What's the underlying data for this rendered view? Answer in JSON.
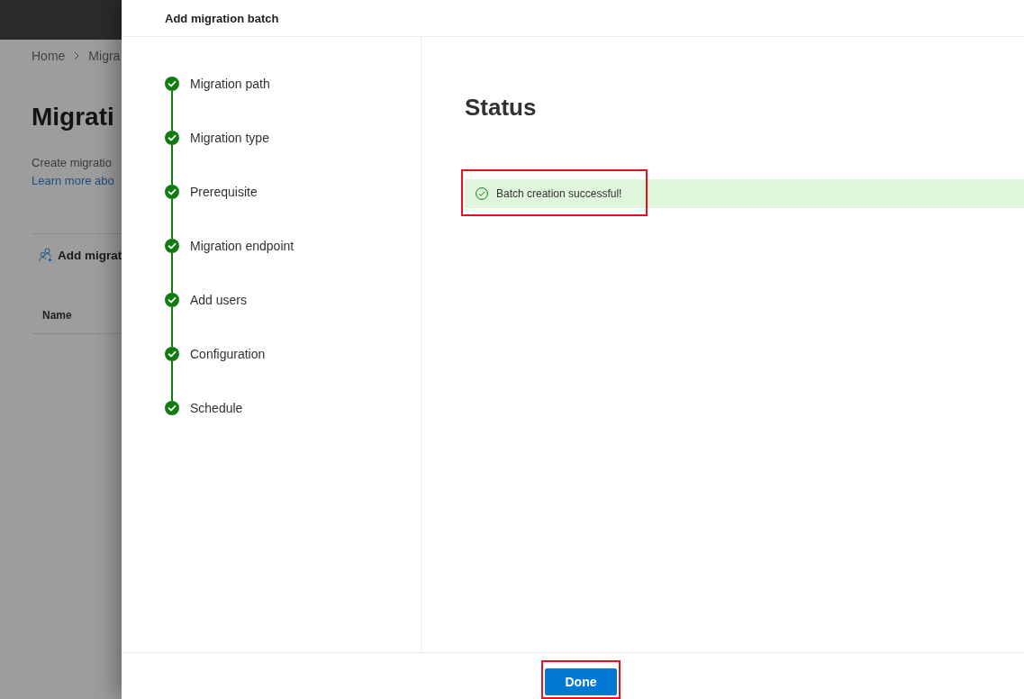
{
  "background_page": {
    "breadcrumb": [
      "Home",
      "Migra"
    ],
    "title": "Migrati",
    "description": "Create migratio",
    "link": "Learn more abo",
    "toolbar": {
      "add_button": "Add migrat"
    },
    "table": {
      "columns": [
        "Name"
      ]
    }
  },
  "panel": {
    "title": "Add migration batch",
    "steps": [
      {
        "label": "Migration path",
        "completed": true
      },
      {
        "label": "Migration type",
        "completed": true
      },
      {
        "label": "Prerequisite",
        "completed": true
      },
      {
        "label": "Migration endpoint",
        "completed": true
      },
      {
        "label": "Add users",
        "completed": true
      },
      {
        "label": "Configuration",
        "completed": true
      },
      {
        "label": "Schedule",
        "completed": true
      }
    ],
    "content": {
      "heading": "Status",
      "message": {
        "kind": "success",
        "text": "Batch creation successful!",
        "highlighted": true
      }
    },
    "footer": {
      "buttons": [
        {
          "label": "Done",
          "kind": "primary",
          "highlighted": true
        }
      ]
    }
  }
}
